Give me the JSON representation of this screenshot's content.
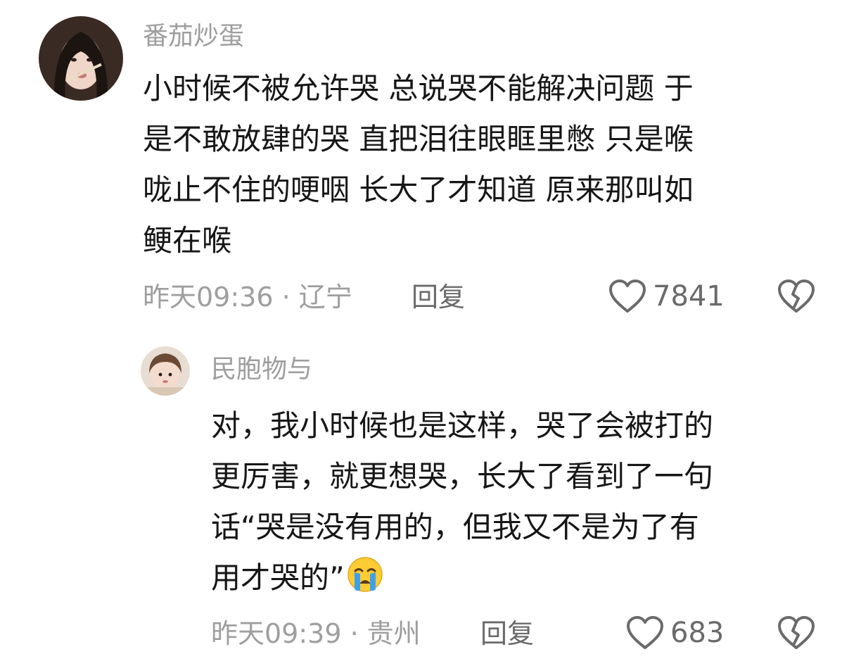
{
  "comments": [
    {
      "username": "番茄炒蛋",
      "content_lines": [
        "小时候不被允许哭 总说哭不能解决问题 于",
        "是不敢放肆的哭 直把泪往眼眶里憋 只是喉",
        "咙止不住的哽咽 长大了才知道 原来那叫如",
        "鲠在喉"
      ],
      "time": "昨天09:36",
      "location": "辽宁",
      "reply_label": "回复",
      "likes": "7841"
    },
    {
      "username": "民胞物与",
      "content_lines": [
        "对，我小时候也是这样，哭了会被打的",
        "更厉害，就更想哭，长大了看到了一句",
        "话“哭是没有用的，但我又不是为了有",
        "用才哭的”"
      ],
      "emoji": "loudly-crying-face",
      "time": "昨天09:39",
      "location": "贵州",
      "reply_label": "回复",
      "likes": "683"
    }
  ],
  "colors": {
    "text": "#161616",
    "muted": "#9e9e9e",
    "action": "#6a6a6a",
    "background": "#ffffff"
  }
}
